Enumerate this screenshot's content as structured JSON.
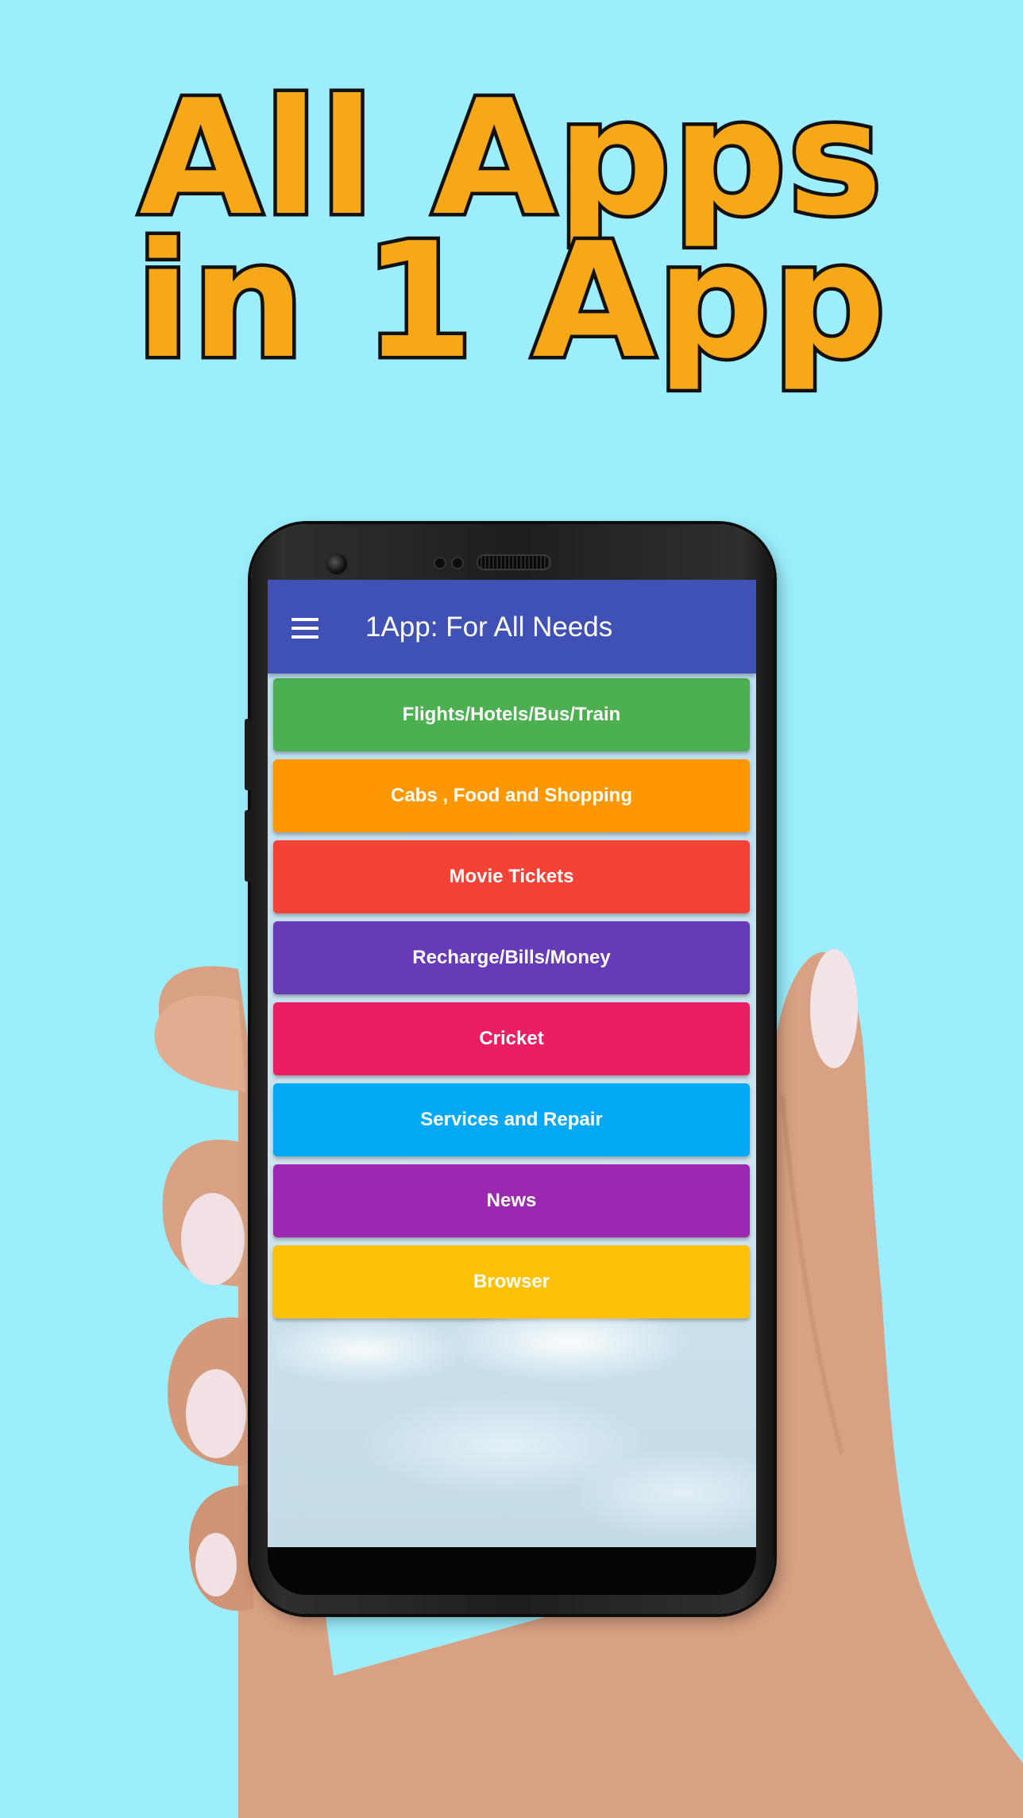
{
  "hero": {
    "line1": "All Apps",
    "line2": "in 1 App"
  },
  "app": {
    "title": "1App: For All Needs",
    "menu_icon": "hamburger-menu-icon"
  },
  "menu": {
    "items": [
      {
        "label": "Flights/Hotels/Bus/Train",
        "color": "#4caf50"
      },
      {
        "label": "Cabs , Food and Shopping",
        "color": "#ff9800"
      },
      {
        "label": "Movie Tickets",
        "color": "#f44336"
      },
      {
        "label": "Recharge/Bills/Money",
        "color": "#673ab7"
      },
      {
        "label": "Cricket",
        "color": "#e91e63"
      },
      {
        "label": "Services and Repair",
        "color": "#03a9f4"
      },
      {
        "label": "News",
        "color": "#9c27b0"
      },
      {
        "label": "Browser",
        "color": "#ffc107"
      }
    ]
  },
  "colors": {
    "background": "#9ceefd",
    "hero_text": "#f7a818",
    "appbar": "#3f51b5"
  }
}
